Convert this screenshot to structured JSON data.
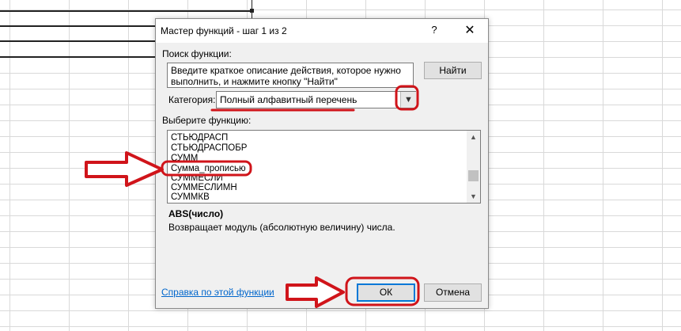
{
  "dialog": {
    "title": "Мастер функций - шаг 1 из 2",
    "help_glyph": "?",
    "close_glyph": "✕",
    "search_label": "Поиск функции:",
    "search_text": "Введите краткое описание действия, которое нужно\nвыполнить, и нажмите кнопку \"Найти\"",
    "find_button": "Найти",
    "category_label": "Категория:",
    "category_value": "Полный алфавитный перечень",
    "choose_label": "Выберите функцию:",
    "functions": [
      "СТЬЮДРАСП",
      "СТЬЮДРАСПОБР",
      "СУММ",
      "Сумма_прописью",
      "СУММЕСЛИ",
      "СУММЕСЛИМН",
      "СУММКВ"
    ],
    "selected_function": "Сумма_прописью",
    "signature": "ABS(число)",
    "description": "Возвращает модуль (абсолютную величину) числа.",
    "help_link": "Справка по этой функции",
    "ok_button": "ОК",
    "cancel_button": "Отмена"
  },
  "icons": {
    "dropdown": "chevron-down-icon",
    "scroll_up": "scroll-up-icon",
    "scroll_down": "scroll-down-icon",
    "annotation_arrow": "red-arrow-icon"
  },
  "colors": {
    "annotation_red": "#d0141a",
    "link_blue": "#0066cc",
    "dialog_bg": "#f0f0f0",
    "focus_blue": "#0078d7"
  }
}
